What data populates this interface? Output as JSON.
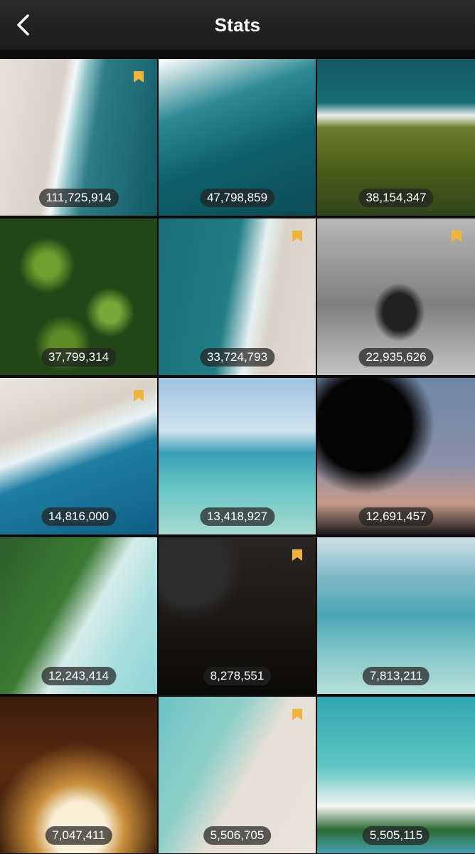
{
  "header": {
    "title": "Stats",
    "back_icon": "chevron-left-icon"
  },
  "colors": {
    "bookmark": "#f0b43c",
    "navbar": "#1f1f1f",
    "background": "#0b0b0b"
  },
  "tiles": [
    {
      "count": "111,725,914",
      "bookmarked": true
    },
    {
      "count": "47,798,859",
      "bookmarked": false
    },
    {
      "count": "38,154,347",
      "bookmarked": false
    },
    {
      "count": "37,799,314",
      "bookmarked": false
    },
    {
      "count": "33,724,793",
      "bookmarked": true
    },
    {
      "count": "22,935,626",
      "bookmarked": true
    },
    {
      "count": "14,816,000",
      "bookmarked": true
    },
    {
      "count": "13,418,927",
      "bookmarked": false
    },
    {
      "count": "12,691,457",
      "bookmarked": false
    },
    {
      "count": "12,243,414",
      "bookmarked": false
    },
    {
      "count": "8,278,551",
      "bookmarked": true
    },
    {
      "count": "7,813,211",
      "bookmarked": false
    },
    {
      "count": "7,047,411",
      "bookmarked": false
    },
    {
      "count": "5,506,705",
      "bookmarked": true
    },
    {
      "count": "5,505,115",
      "bookmarked": false
    }
  ]
}
